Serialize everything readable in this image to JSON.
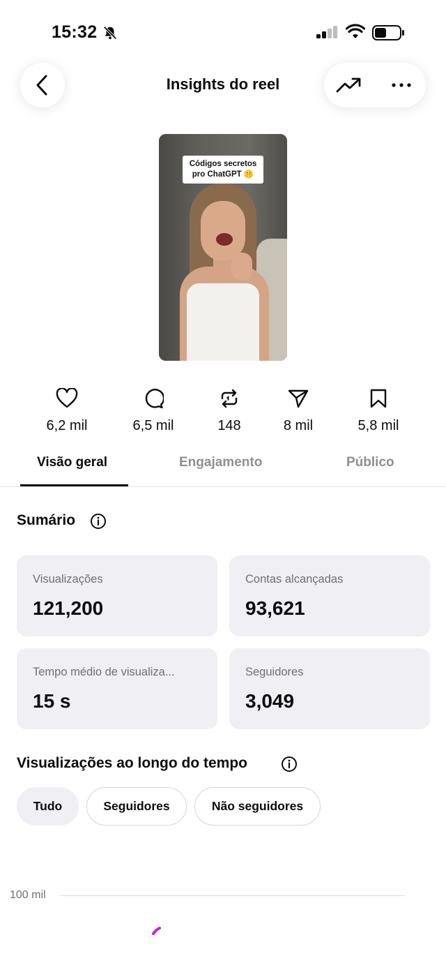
{
  "status_bar": {
    "time": "15:32"
  },
  "header": {
    "title": "Insights do reel"
  },
  "thumbnail": {
    "caption_line1": "Códigos secretos",
    "caption_line2": "pro ChatGPT 🤫"
  },
  "stats": [
    {
      "icon": "heart-icon",
      "value": "6,2 mil"
    },
    {
      "icon": "comment-icon",
      "value": "6,5 mil"
    },
    {
      "icon": "repost-icon",
      "value": "148"
    },
    {
      "icon": "share-icon",
      "value": "8 mil"
    },
    {
      "icon": "bookmark-icon",
      "value": "5,8 mil"
    }
  ],
  "tabs": [
    {
      "label": "Visão geral",
      "active": true
    },
    {
      "label": "Engajamento",
      "active": false
    },
    {
      "label": "Público",
      "active": false
    }
  ],
  "summary": {
    "title": "Sumário",
    "cards": [
      {
        "label": "Visualizações",
        "value": "121,200"
      },
      {
        "label": "Contas alcançadas",
        "value": "93,621"
      },
      {
        "label": "Tempo médio de visualiza...",
        "value": "15 s"
      },
      {
        "label": "Seguidores",
        "value": "3,049"
      }
    ]
  },
  "views_over_time": {
    "title": "Visualizações ao longo do tempo",
    "filters": [
      {
        "label": "Tudo",
        "selected": true
      },
      {
        "label": "Seguidores",
        "selected": false
      },
      {
        "label": "Não seguidores",
        "selected": false
      }
    ],
    "y_tick": "100 mil",
    "line_color": "#c026d3"
  }
}
